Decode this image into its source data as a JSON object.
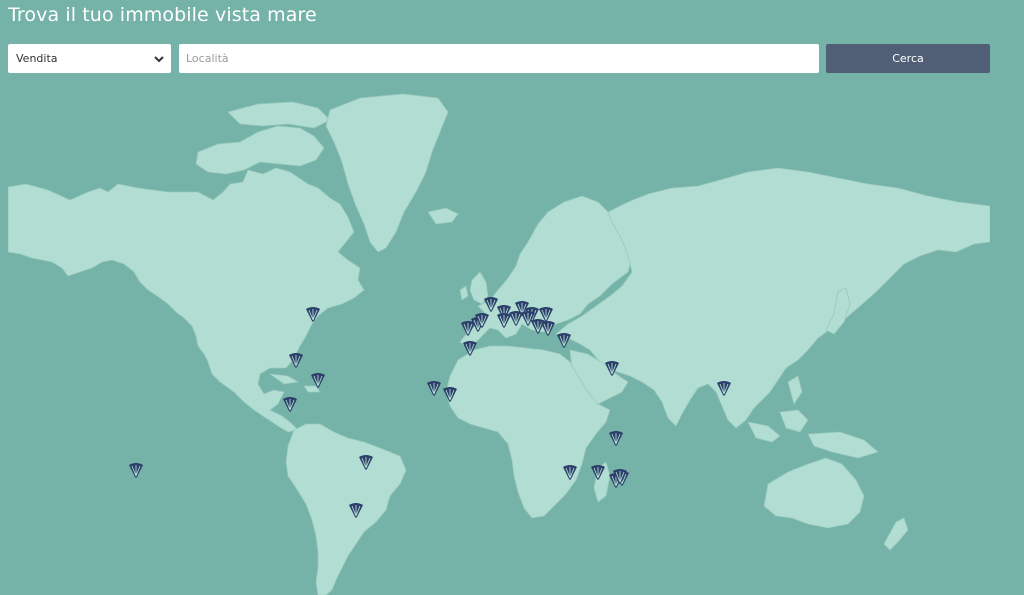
{
  "page": {
    "title": "Trova il tuo immobile vista mare"
  },
  "search": {
    "type_value": "Vendita",
    "type_options": [
      "Vendita"
    ],
    "location_placeholder": "Località",
    "location_value": "",
    "submit_label": "Cerca"
  },
  "map": {
    "ocean_color": "#75b2a7",
    "land_color": "#b2ddd2",
    "border_color": "#98cabd",
    "marker_color": "#2c3e6a",
    "marker_icon": "property-pin-icon",
    "marker_count": 32
  }
}
